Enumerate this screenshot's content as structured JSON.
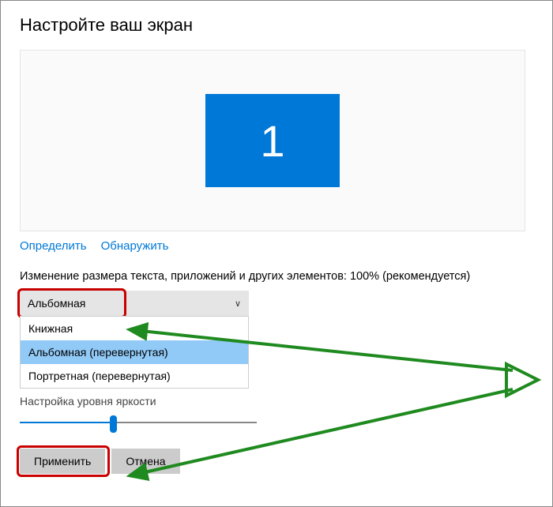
{
  "title": "Настройте ваш экран",
  "monitor": {
    "number": "1"
  },
  "links": {
    "identify": "Определить",
    "detect": "Обнаружить"
  },
  "scale_label": "Изменение размера текста, приложений и других элементов: 100% (рекомендуется)",
  "orientation": {
    "selected": "Альбомная",
    "options": [
      "Книжная",
      "Альбомная (перевернутая)",
      "Портретная (перевернутая)"
    ],
    "hover_index": 1
  },
  "brightness_label": "Настройка уровня яркости",
  "buttons": {
    "apply": "Применить",
    "cancel": "Отмена"
  },
  "colors": {
    "accent": "#0078d7",
    "highlight": "#c80000",
    "arrow": "#1f8a1f"
  }
}
